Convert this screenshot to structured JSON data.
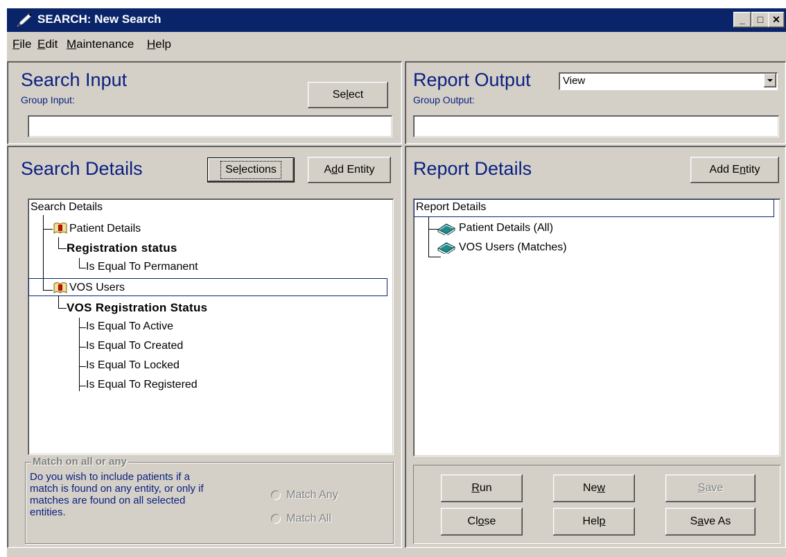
{
  "window": {
    "title": "SEARCH: New Search",
    "min_glyph": "_",
    "max_glyph": "□",
    "close_glyph": "✕"
  },
  "menu": {
    "items": [
      "File",
      "Edit",
      "Maintenance",
      "Help"
    ]
  },
  "search_input": {
    "heading": "Search Input",
    "group_label": "Group Input:",
    "select_button": "Select",
    "group_value": ""
  },
  "report_output": {
    "heading": "Report Output",
    "dropdown_value": "View",
    "group_label": "Group Output:",
    "group_value": ""
  },
  "search_details": {
    "heading": "Search Details",
    "selections_button": "Selections",
    "add_entity_button": "Add Entity",
    "tree": {
      "root": "Search Details",
      "nodes": [
        "Patient Details",
        "Registration status",
        "Is Equal To Permanent",
        "VOS Users",
        "VOS Registration Status",
        "Is Equal To Active",
        "Is Equal To Created",
        "Is Equal To Locked",
        "Is Equal To Registered"
      ]
    }
  },
  "report_details": {
    "heading": "Report Details",
    "add_entity_button": "Add Entity",
    "tree": {
      "root": "Report Details",
      "nodes": [
        "Patient Details (All)",
        "VOS Users (Matches)"
      ]
    }
  },
  "match": {
    "legend": "Match on all or any",
    "description": "Do you wish to include patients if a match is found on any entity, or only if matches are found on all selected entities.",
    "lines": [
      "Do you wish to include patients if a",
      "match is found on any entity, or only if",
      "matches are found on all selected",
      "entities."
    ],
    "option_any": "Match Any",
    "option_all": "Match All"
  },
  "actions": {
    "run": "Run",
    "new": "New",
    "save": "Save",
    "close": "Close",
    "help": "Help",
    "save_as": "Save As"
  },
  "colors": {
    "title_bar": "#0a246a",
    "heading_blue": "#0a2080",
    "face": "#d4d0c8",
    "book_teal": "#1f8a8a",
    "book_red": "#c00000"
  },
  "icons": [
    "app-pen-icon",
    "book-icon",
    "book-stack-icon"
  ]
}
